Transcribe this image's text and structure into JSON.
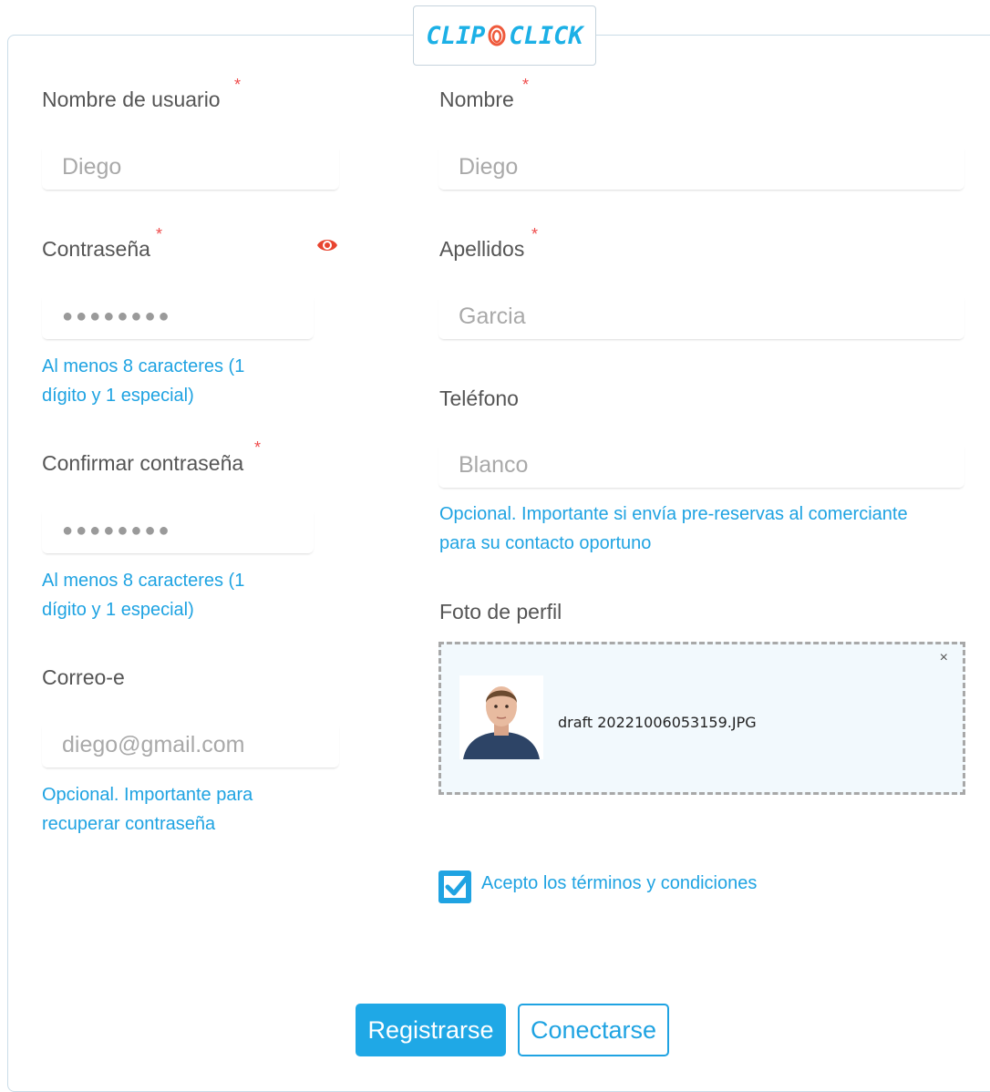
{
  "brand": {
    "logo_left": "CLIP",
    "logo_right": "CLICK"
  },
  "colors": {
    "accent": "#1fa3e2",
    "required": "#ef4c4c",
    "eye_icon": "#e8442f"
  },
  "left": {
    "username": {
      "label": "Nombre de usuario",
      "required_mark": "*",
      "placeholder": "Diego"
    },
    "password": {
      "label": "Contraseña",
      "required_mark": "*",
      "value": "●●●●●●●●",
      "hint_line1": "Al menos 8 caracteres (1",
      "hint_line2": "dígito y 1 especial)",
      "toggle_icon": "eye-icon"
    },
    "confirm_password": {
      "label": "Confirmar contraseña",
      "required_mark": "*",
      "value": "●●●●●●●●",
      "hint_line1": "Al menos 8 caracteres (1",
      "hint_line2": "dígito y 1 especial)"
    },
    "email": {
      "label": "Correo-e",
      "placeholder": "diego@gmail.com",
      "hint_line1": "Opcional. Importante para",
      "hint_line2": "recuperar contraseña"
    }
  },
  "right": {
    "first_name": {
      "label": "Nombre",
      "required_mark": "*",
      "placeholder": "Diego"
    },
    "last_name": {
      "label": "Apellidos",
      "required_mark": "*",
      "placeholder": "Garcia"
    },
    "phone": {
      "label": "Teléfono",
      "placeholder": "Blanco",
      "hint_line1": "Opcional. Importante si envía pre-reservas al comerciante",
      "hint_line2": "para su contacto oportuno"
    },
    "photo": {
      "label": "Foto de perfil",
      "file_name": "draft 20221006053159.JPG",
      "remove": "×"
    },
    "terms": {
      "checked": true,
      "label": "Acepto los términos y condiciones"
    }
  },
  "actions": {
    "register": "Registrarse",
    "login": "Conectarse"
  }
}
